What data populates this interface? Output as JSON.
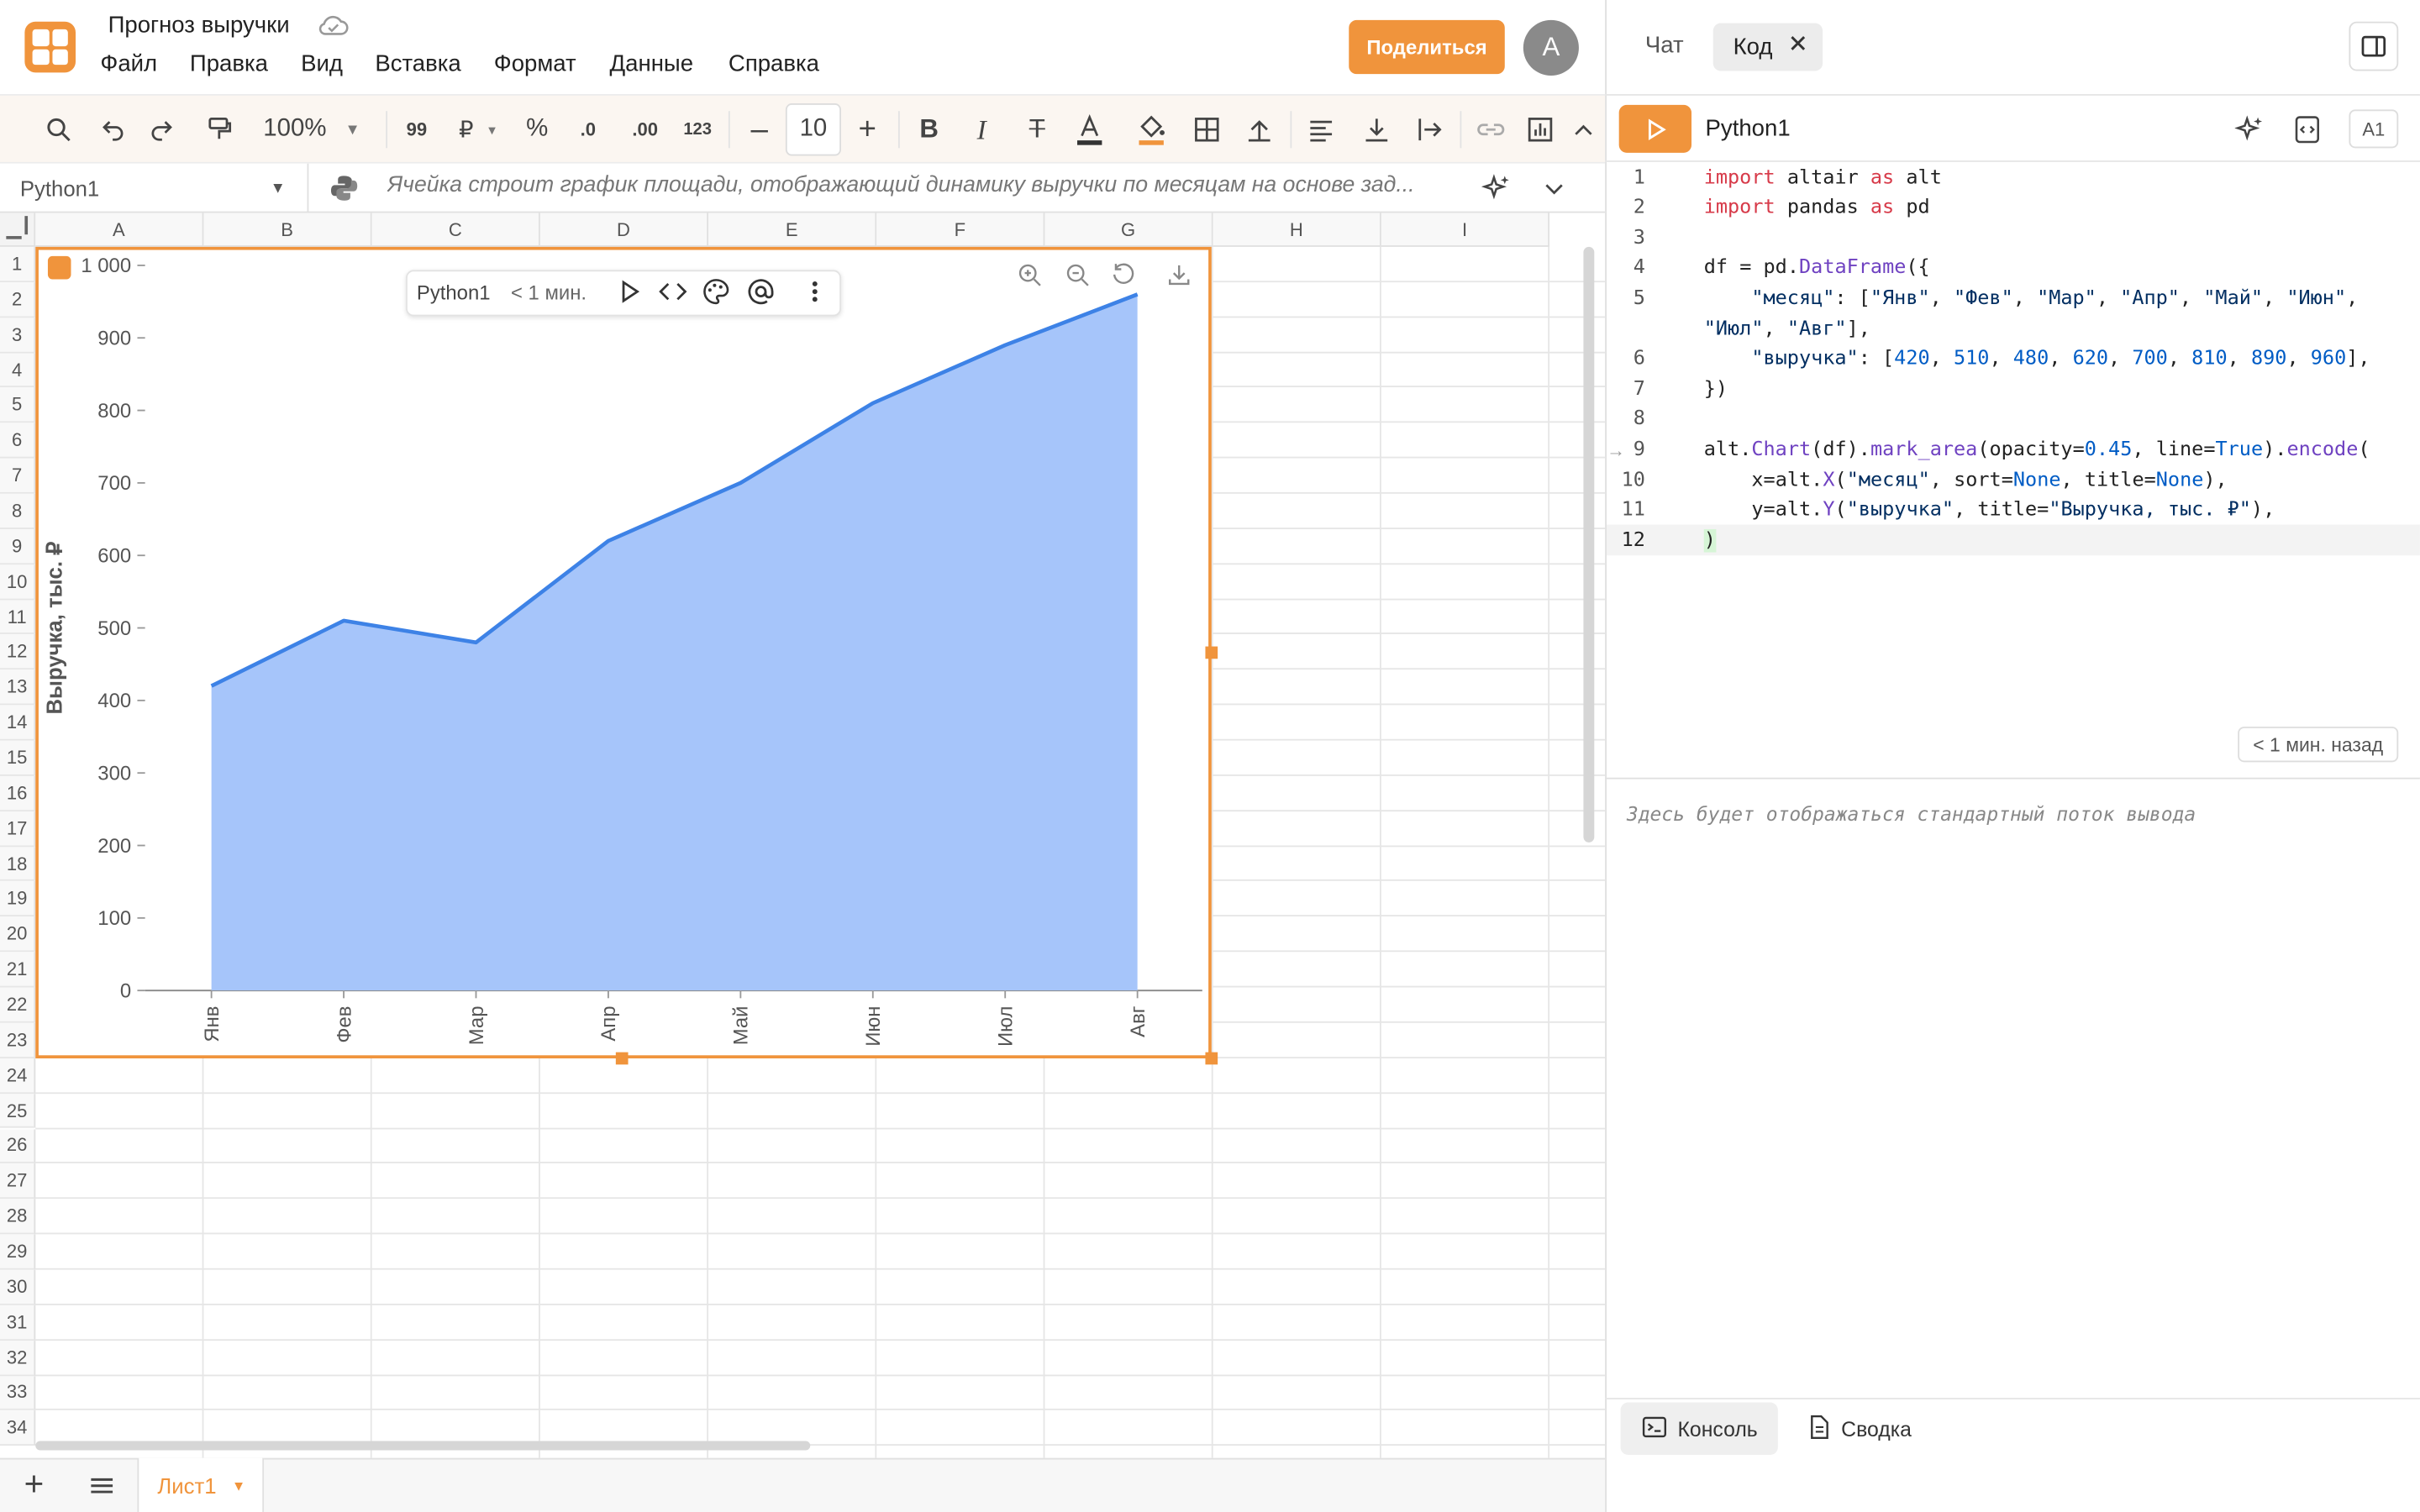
{
  "app": {
    "doc_title": "Прогноз выручки",
    "menu": [
      "Файл",
      "Правка",
      "Вид",
      "Вставка",
      "Формат",
      "Данные",
      "Справка"
    ],
    "share_label": "Поделиться",
    "avatar_letter": "А",
    "accent": "#f0943c"
  },
  "toolbar": {
    "zoom": "100%",
    "font_size": "10",
    "num_fmt_quote": "99",
    "currency": "₽",
    "percent": "%",
    "dec_less": ".0",
    "dec_more": ".00",
    "num_123": "123"
  },
  "formula_bar": {
    "name_box": "Python1",
    "text": "Ячейка строит график площади, отображающий динамику выручки по месяцам на основе зад..."
  },
  "grid": {
    "columns": [
      "A",
      "B",
      "C",
      "D",
      "E",
      "F",
      "G",
      "H",
      "I"
    ],
    "rows": [
      "1",
      "2",
      "3",
      "4",
      "5",
      "6",
      "7",
      "8",
      "9",
      "10",
      "11",
      "12",
      "13",
      "14",
      "15",
      "16",
      "17",
      "18",
      "19",
      "20",
      "21",
      "22",
      "23",
      "24",
      "25",
      "26",
      "27",
      "28",
      "29",
      "30",
      "31",
      "32",
      "33",
      "34"
    ]
  },
  "chart_toolbar": {
    "name": "Python1",
    "time": "< 1 мин."
  },
  "chart_data": {
    "type": "area",
    "categories": [
      "Янв",
      "Фев",
      "Мар",
      "Апр",
      "Май",
      "Июн",
      "Июл",
      "Авг"
    ],
    "values": [
      420,
      510,
      480,
      620,
      700,
      810,
      890,
      960
    ],
    "ylabel": "Выручка, тыс. ₽",
    "xlabel": "",
    "ylim": [
      0,
      1000
    ],
    "yticks": [
      "0",
      "100",
      "200",
      "300",
      "400",
      "500",
      "600",
      "700",
      "800",
      "900",
      "1 000"
    ],
    "fill_color": "#a6c5fa",
    "line_color": "#3d82e6",
    "grid": false
  },
  "sheet_tabs": {
    "active": "Лист1"
  },
  "panel": {
    "tabs": {
      "chat": "Чат",
      "code": "Код"
    },
    "cell_name": "Python1",
    "cell_ref": "A1",
    "code_lines": [
      {
        "n": "1",
        "t": "import altair as alt"
      },
      {
        "n": "2",
        "t": "import pandas as pd"
      },
      {
        "n": "3",
        "t": ""
      },
      {
        "n": "4",
        "t": "df = pd.DataFrame({"
      },
      {
        "n": "5",
        "t": "    \"месяц\": [\"Янв\", \"Фев\", \"Мар\", \"Апр\", \"Май\", \"Июн\","
      },
      {
        "n": "",
        "t": "\"Июл\", \"Авг\"],"
      },
      {
        "n": "6",
        "t": "    \"выручка\": [420, 510, 480, 620, 700, 810, 890, 960],"
      },
      {
        "n": "7",
        "t": "})"
      },
      {
        "n": "8",
        "t": ""
      },
      {
        "n": "9",
        "t": "alt.Chart(df).mark_area(opacity=0.45, line=True).encode("
      },
      {
        "n": "10",
        "t": "    x=alt.X(\"месяц\", sort=None, title=None),"
      },
      {
        "n": "11",
        "t": "    y=alt.Y(\"выручка\", title=\"Выручка, тыс. ₽\"),"
      },
      {
        "n": "12",
        "t": ")"
      }
    ],
    "last_run": "< 1 мин. назад",
    "stdout_placeholder": "Здесь будет отображаться стандартный поток вывода",
    "bottom_tabs": {
      "console": "Консоль",
      "summary": "Сводка"
    }
  }
}
